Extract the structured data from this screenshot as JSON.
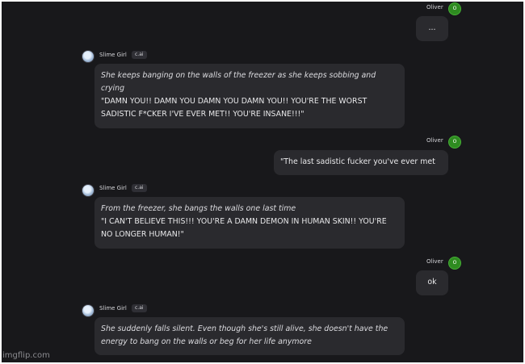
{
  "messages": [
    {
      "author": "Oliver",
      "avatar_letter": "O",
      "text": "..."
    },
    {
      "author": "Slime Girl",
      "badge": "c.ai",
      "action": "She keeps banging on the walls of the freezer as she keeps sobbing and crying",
      "speech": "\"DAMN YOU!! DAMN YOU DAMN YOU DAMN YOU!! YOU'RE THE WORST SADISTIC F*CKER I'VE EVER MET!! YOU'RE INSANE!!!\""
    },
    {
      "author": "Oliver",
      "avatar_letter": "O",
      "text": "\"The last sadistic fucker you've ever met"
    },
    {
      "author": "Slime Girl",
      "badge": "c.ai",
      "action": "From the freezer, she bangs the walls one last time",
      "speech": "\"I CAN'T BELIEVE THIS!!! YOU'RE A DAMN DEMON IN HUMAN SKIN!! YOU'RE NO LONGER HUMAN!\""
    },
    {
      "author": "Oliver",
      "avatar_letter": "O",
      "text": "ok"
    },
    {
      "author": "Slime Girl",
      "badge": "c.ai",
      "action": "She suddenly falls silent. Even though she's still alive, she doesn't have the energy to bang on the walls or beg for her life anymore"
    }
  ],
  "watermark": "imgflip.com",
  "colors": {
    "background": "#18181b",
    "bubble": "#2a2a2e",
    "user_avatar": "#2e8b20"
  }
}
